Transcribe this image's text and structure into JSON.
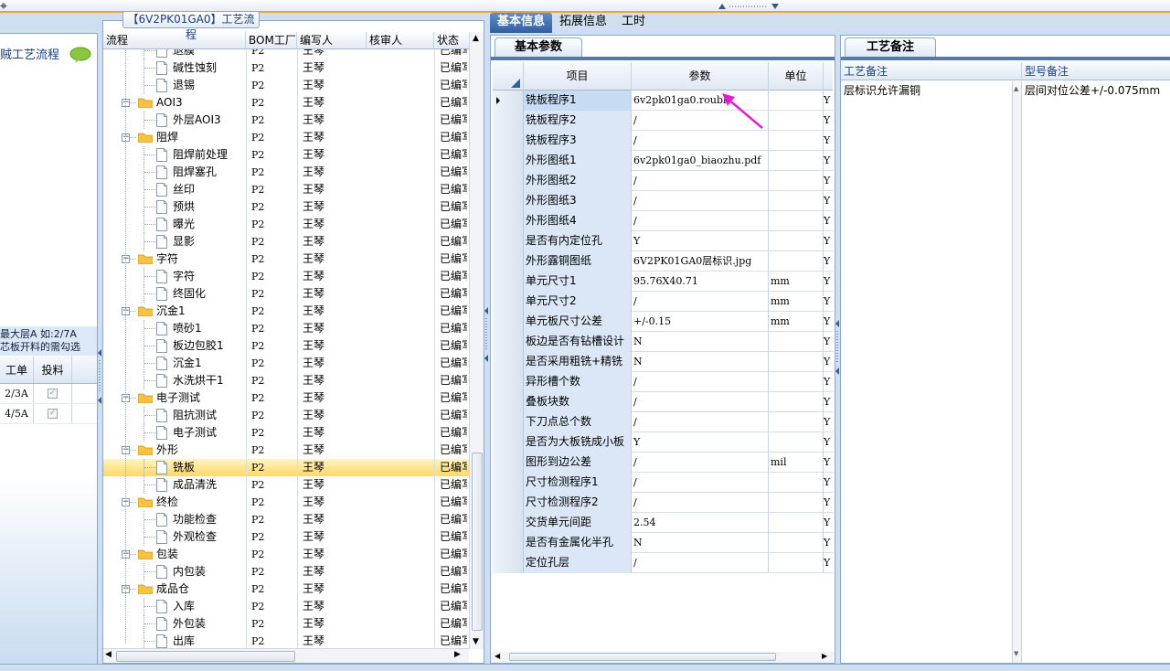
{
  "left_panel": {
    "title": "贼工艺流程",
    "info_line1": "最大层A 如:2/7A",
    "info_line2": "芯板开料的需勾选",
    "grid_headers": [
      "工单",
      "投料"
    ],
    "grid_rows": [
      {
        "order": "2/3A",
        "checked": true
      },
      {
        "order": "4/5A",
        "checked": true
      }
    ]
  },
  "tree": {
    "title": "【6V2PK01GA0】工艺流程",
    "headers": {
      "flow": "流程",
      "bom": "BOM工厂",
      "author": "编写人",
      "reviewer": "核审人",
      "status": "状态"
    },
    "rows": [
      {
        "name": "退膜",
        "type": "leaf",
        "bom": "P2",
        "author": "王琴",
        "status": "已编写"
      },
      {
        "name": "碱性蚀刻",
        "type": "leaf",
        "bom": "P2",
        "author": "王琴",
        "status": "已编写"
      },
      {
        "name": "退锡",
        "type": "leaf",
        "bom": "P2",
        "author": "王琴",
        "status": "已编写"
      },
      {
        "name": "AOI3",
        "type": "folder",
        "bom": "P2",
        "author": "王琴",
        "status": "已编写"
      },
      {
        "name": "外层AOI3",
        "type": "leaf",
        "bom": "P2",
        "author": "王琴",
        "status": "已编写"
      },
      {
        "name": "阻焊",
        "type": "folder",
        "bom": "P2",
        "author": "王琴",
        "status": "已编写"
      },
      {
        "name": "阻焊前处理",
        "type": "leaf",
        "bom": "P2",
        "author": "王琴",
        "status": "已编写"
      },
      {
        "name": "阻焊塞孔",
        "type": "leaf",
        "bom": "P2",
        "author": "王琴",
        "status": "已编写"
      },
      {
        "name": "丝印",
        "type": "leaf",
        "bom": "P2",
        "author": "王琴",
        "status": "已编写"
      },
      {
        "name": "预烘",
        "type": "leaf",
        "bom": "P2",
        "author": "王琴",
        "status": "已编写"
      },
      {
        "name": "曝光",
        "type": "leaf",
        "bom": "P2",
        "author": "王琴",
        "status": "已编写"
      },
      {
        "name": "显影",
        "type": "leaf",
        "bom": "P2",
        "author": "王琴",
        "status": "已编写"
      },
      {
        "name": "字符",
        "type": "folder",
        "bom": "P2",
        "author": "王琴",
        "status": "已编写"
      },
      {
        "name": "字符",
        "type": "leaf",
        "bom": "P2",
        "author": "王琴",
        "status": "已编写"
      },
      {
        "name": "终固化",
        "type": "leaf",
        "bom": "P2",
        "author": "王琴",
        "status": "已编写"
      },
      {
        "name": "沉金1",
        "type": "folder",
        "bom": "P2",
        "author": "王琴",
        "status": "已编写"
      },
      {
        "name": "喷砂1",
        "type": "leaf",
        "bom": "P2",
        "author": "王琴",
        "status": "已编写"
      },
      {
        "name": "板边包胶1",
        "type": "leaf",
        "bom": "P2",
        "author": "王琴",
        "status": "已编写"
      },
      {
        "name": "沉金1",
        "type": "leaf",
        "bom": "P2",
        "author": "王琴",
        "status": "已编写"
      },
      {
        "name": "水洗烘干1",
        "type": "leaf",
        "bom": "P2",
        "author": "王琴",
        "status": "已编写"
      },
      {
        "name": "电子测试",
        "type": "folder",
        "bom": "P2",
        "author": "王琴",
        "status": "已编写"
      },
      {
        "name": "阻抗测试",
        "type": "leaf",
        "bom": "P2",
        "author": "王琴",
        "status": "已编写"
      },
      {
        "name": "电子测试",
        "type": "leaf",
        "bom": "P2",
        "author": "王琴",
        "status": "已编写"
      },
      {
        "name": "外形",
        "type": "folder",
        "bom": "P2",
        "author": "王琴",
        "status": "已编写"
      },
      {
        "name": "铣板",
        "type": "leaf",
        "bom": "P2",
        "author": "王琴",
        "status": "已编写",
        "selected": true
      },
      {
        "name": "成品清洗",
        "type": "leaf",
        "bom": "P2",
        "author": "王琴",
        "status": "已编写"
      },
      {
        "name": "终检",
        "type": "folder",
        "bom": "P2",
        "author": "王琴",
        "status": "已编写"
      },
      {
        "name": "功能检查",
        "type": "leaf",
        "bom": "P2",
        "author": "王琴",
        "status": "已编写"
      },
      {
        "name": "外观检查",
        "type": "leaf",
        "bom": "P2",
        "author": "王琴",
        "status": "已编写"
      },
      {
        "name": "包装",
        "type": "folder",
        "bom": "P2",
        "author": "王琴",
        "status": "已编写"
      },
      {
        "name": "内包装",
        "type": "leaf",
        "bom": "P2",
        "author": "王琴",
        "status": "已编写"
      },
      {
        "name": "成品仓",
        "type": "folder",
        "bom": "P2",
        "author": "王琴",
        "status": "已编写"
      },
      {
        "name": "入库",
        "type": "leaf",
        "bom": "P2",
        "author": "王琴",
        "status": "已编写"
      },
      {
        "name": "外包装",
        "type": "leaf",
        "bom": "P2",
        "author": "王琴",
        "status": "已编写"
      },
      {
        "name": "出库",
        "type": "leaf",
        "bom": "P2",
        "author": "王琴",
        "status": "已编写"
      }
    ]
  },
  "main_tabs": [
    "基本信息",
    "拓展信息",
    "工时"
  ],
  "params": {
    "tab": "基本参数",
    "headers": {
      "item": "项目",
      "value": "参数",
      "unit": "单位"
    },
    "rows": [
      {
        "item": "铣板程序1",
        "value": "6v2pk01ga0.roubk",
        "unit": "",
        "flag": "Y",
        "selected": true
      },
      {
        "item": "铣板程序2",
        "value": "/",
        "unit": "",
        "flag": "Y"
      },
      {
        "item": "铣板程序3",
        "value": "/",
        "unit": "",
        "flag": "Y"
      },
      {
        "item": "外形图纸1",
        "value": "6v2pk01ga0_biaozhu.pdf",
        "unit": "",
        "flag": "Y"
      },
      {
        "item": "外形图纸2",
        "value": "/",
        "unit": "",
        "flag": "Y"
      },
      {
        "item": "外形图纸3",
        "value": "/",
        "unit": "",
        "flag": "Y"
      },
      {
        "item": "外形图纸4",
        "value": "/",
        "unit": "",
        "flag": "Y"
      },
      {
        "item": "是否有内定位孔",
        "value": "Y",
        "unit": "",
        "flag": "Y"
      },
      {
        "item": "外形露铜图纸",
        "value": "6V2PK01GA0层标识.jpg",
        "unit": "",
        "flag": "Y"
      },
      {
        "item": "单元尺寸1",
        "value": "95.76X40.71",
        "unit": "mm",
        "flag": "Y"
      },
      {
        "item": "单元尺寸2",
        "value": "/",
        "unit": "mm",
        "flag": "Y"
      },
      {
        "item": "单元板尺寸公差",
        "value": "+/-0.15",
        "unit": "mm",
        "flag": "Y"
      },
      {
        "item": "板边是否有钻槽设计",
        "value": "N",
        "unit": "",
        "flag": "Y"
      },
      {
        "item": "是否采用粗铣+精铣",
        "value": "N",
        "unit": "",
        "flag": "Y"
      },
      {
        "item": "异形槽个数",
        "value": "/",
        "unit": "",
        "flag": "Y"
      },
      {
        "item": "叠板块数",
        "value": "/",
        "unit": "",
        "flag": "Y"
      },
      {
        "item": "下刀点总个数",
        "value": "/",
        "unit": "",
        "flag": "Y"
      },
      {
        "item": "是否为大板铣成小板",
        "value": "Y",
        "unit": "",
        "flag": "Y"
      },
      {
        "item": "图形到边公差",
        "value": "/",
        "unit": "mil",
        "flag": "Y"
      },
      {
        "item": "尺寸检测程序1",
        "value": "/",
        "unit": "",
        "flag": "Y"
      },
      {
        "item": "尺寸检测程序2",
        "value": "/",
        "unit": "",
        "flag": "Y"
      },
      {
        "item": "交货单元间距",
        "value": "2.54",
        "unit": "",
        "flag": "Y"
      },
      {
        "item": "是否有金属化半孔",
        "value": "N",
        "unit": "",
        "flag": "Y"
      },
      {
        "item": "定位孔层",
        "value": "/",
        "unit": "",
        "flag": "Y"
      }
    ]
  },
  "notes": {
    "tab": "工艺备注",
    "headers": {
      "process": "工艺备注",
      "model": "型号备注"
    },
    "process_text": "层标识允许漏铜",
    "model_text": "层间对位公差+/-0.075mm"
  },
  "colors": {
    "accent": "#2f5f9e",
    "selection": "#ffd867",
    "annotation_arrow": "#e020d0"
  }
}
